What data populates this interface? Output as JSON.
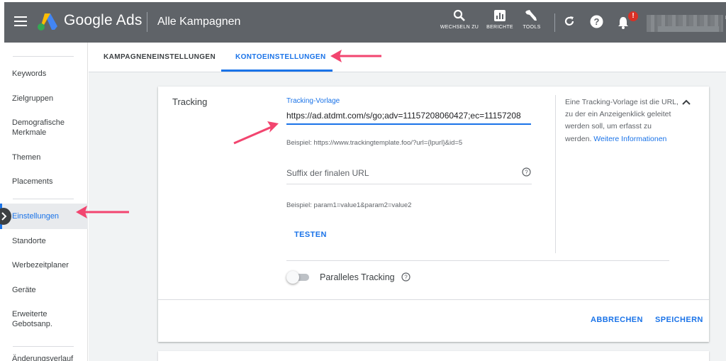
{
  "topbar": {
    "brand": "Google Ads",
    "title": "Alle Kampagnen",
    "tools": [
      {
        "label": "WECHSELN ZU",
        "icon": "search-icon"
      },
      {
        "label": "BERICHTE",
        "icon": "reports-icon"
      },
      {
        "label": "TOOLS",
        "icon": "wrench-icon"
      }
    ],
    "notification_count": "!",
    "account_tail": "r"
  },
  "nav": {
    "items": [
      {
        "label": "Keywords"
      },
      {
        "label": "Zielgruppen"
      },
      {
        "label": "Demografische Merkmale"
      },
      {
        "label": "Themen"
      },
      {
        "label": "Placements"
      },
      {
        "label": "Einstellungen",
        "active": true
      },
      {
        "label": "Standorte"
      },
      {
        "label": "Werbezeitplaner"
      },
      {
        "label": "Geräte"
      },
      {
        "label": "Erweiterte Gebotsanp."
      },
      {
        "label": "Änderungsverlauf"
      }
    ]
  },
  "tabs": [
    {
      "label": "KAMPAGNENEINSTELLUNGEN",
      "active": false
    },
    {
      "label": "KONTOEINSTELLUNGEN",
      "active": true
    }
  ],
  "tracking": {
    "section_title": "Tracking",
    "template_label": "Tracking-Vorlage",
    "template_value": "https://ad.atdmt.com/s/go;adv=11157208060427;ec=11157208",
    "template_hint": "Beispiel: https://www.trackingtemplate.foo/?url={lpurl}&id=5",
    "suffix_placeholder": "Suffix der finalen URL",
    "suffix_hint": "Beispiel: param1=value1&param2=value2",
    "test_label": "TESTEN",
    "help_text": "Eine Tracking-Vorlage ist die URL, zu der ein Anzeigenklick geleitet werden soll, um erfasst zu werden.",
    "help_link": "Weitere Informationen",
    "parallel_label": "Paralleles Tracking",
    "parallel_on": false,
    "cancel_label": "ABBRECHEN",
    "save_label": "SPEICHERN"
  },
  "colors": {
    "topbar": "#5f6368",
    "accent": "#1a73e8",
    "annotation_arrow": "#f2456f"
  }
}
